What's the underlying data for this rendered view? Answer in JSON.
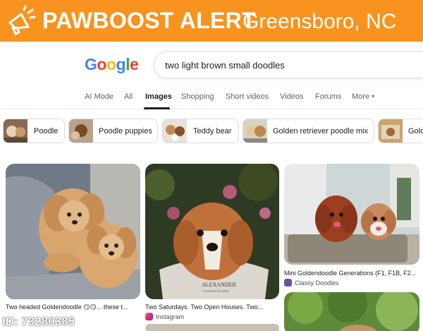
{
  "banner": {
    "brand": "PAWBOOST ALERT",
    "city": "Greensboro, NC",
    "color": "#f7931e"
  },
  "google": {
    "logo_letters": [
      "G",
      "o",
      "o",
      "g",
      "l",
      "e"
    ],
    "logo_colors": [
      "#4285f4",
      "#ea4335",
      "#fbbc05",
      "#4285f4",
      "#34a853",
      "#ea4335"
    ],
    "query": "two light brown small doodles"
  },
  "tabs": {
    "ai_mode": "AI Mode",
    "all": "All",
    "images": "Images",
    "shopping": "Shopping",
    "short_videos": "Short videos",
    "videos": "Videos",
    "forums": "Forums",
    "more": "More",
    "active": "Images"
  },
  "chips": {
    "poodle": "Poodle",
    "poodle_puppies": "Poodle puppies",
    "teddy_bear": "Teddy bear",
    "golden_retriever_poodle_mix": "Golden retriever poodle mix",
    "gold_partial": "Gold"
  },
  "results": {
    "r1": {
      "title": "Two headed Goldendoodle 😏😏... these t...",
      "source": ""
    },
    "r2": {
      "title": "Two Saturdays. Two Open Houses. Two...",
      "source": "Instagram"
    },
    "r3": {
      "title": "Mini Goldendoodle Generations (F1, F1B, F2...",
      "source": "Classy Doodles"
    }
  },
  "photo_text": {
    "alexander": "ALEXANDER",
    "breeder": "Crossbred Doodles"
  },
  "id_tag": "ID: 73280385"
}
